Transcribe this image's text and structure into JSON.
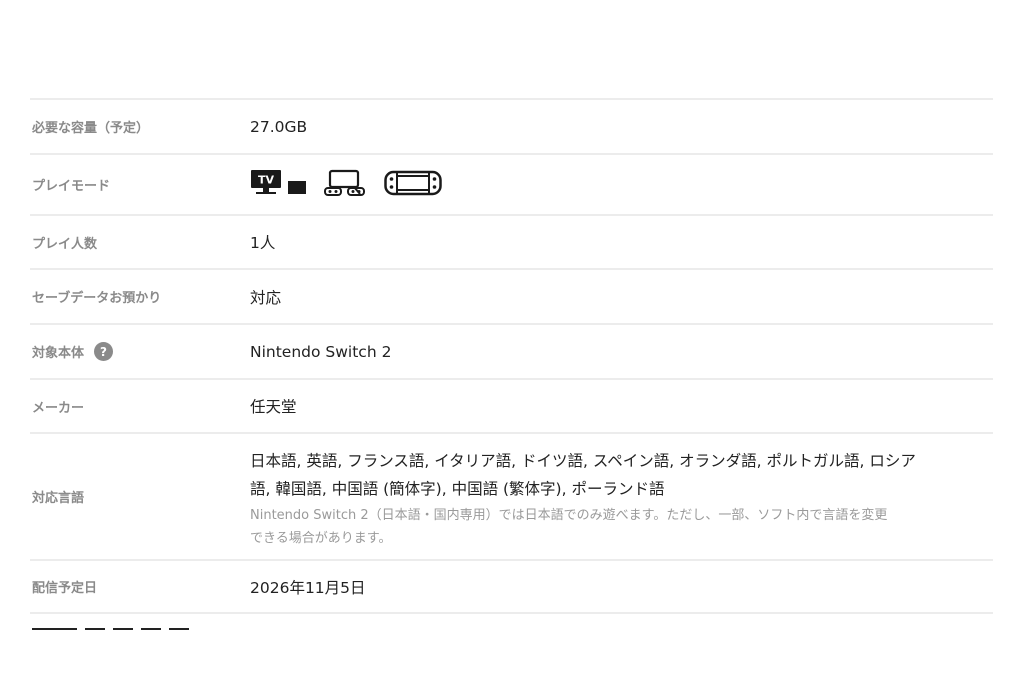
{
  "spec_rows": {
    "storage": {
      "label": "必要な容量（予定）",
      "value": "27.0GB"
    },
    "play_mode": {
      "label": "プレイモード",
      "modes": [
        {
          "icon": "tv-mode-icon",
          "tv_text": "TV"
        },
        {
          "icon": "tabletop-mode-icon"
        },
        {
          "icon": "handheld-mode-icon"
        }
      ]
    },
    "players": {
      "label": "プレイ人数",
      "value": "1人"
    },
    "cloud_save": {
      "label": "セーブデータお預かり",
      "value": "対応"
    },
    "console": {
      "label": "対象本体",
      "help_symbol": "?",
      "value": "Nintendo Switch 2"
    },
    "maker": {
      "label": "メーカー",
      "value": "任天堂"
    },
    "languages": {
      "label": "対応言語",
      "value_line1": "日本語, 英語, フランス語, イタリア語, ドイツ語, スペイン語, オランダ語, ポルトガル語, ロシア",
      "value_line2": "語, 韓国語, 中国語 (簡体字), 中国語 (繁体字), ポーランド語",
      "note_line1": "Nintendo Switch 2（日本語・国内専用）では日本語でのみ遊べます。ただし、一部、ソフト内で言語を変更",
      "note_line2": "できる場合があります。"
    },
    "release_date": {
      "label": "配信予定日",
      "value": "2026年11月5日"
    }
  },
  "colors": {
    "label": "#8a8a8a",
    "text": "#222222",
    "divider": "#ececec",
    "note": "#9a9a9a"
  }
}
